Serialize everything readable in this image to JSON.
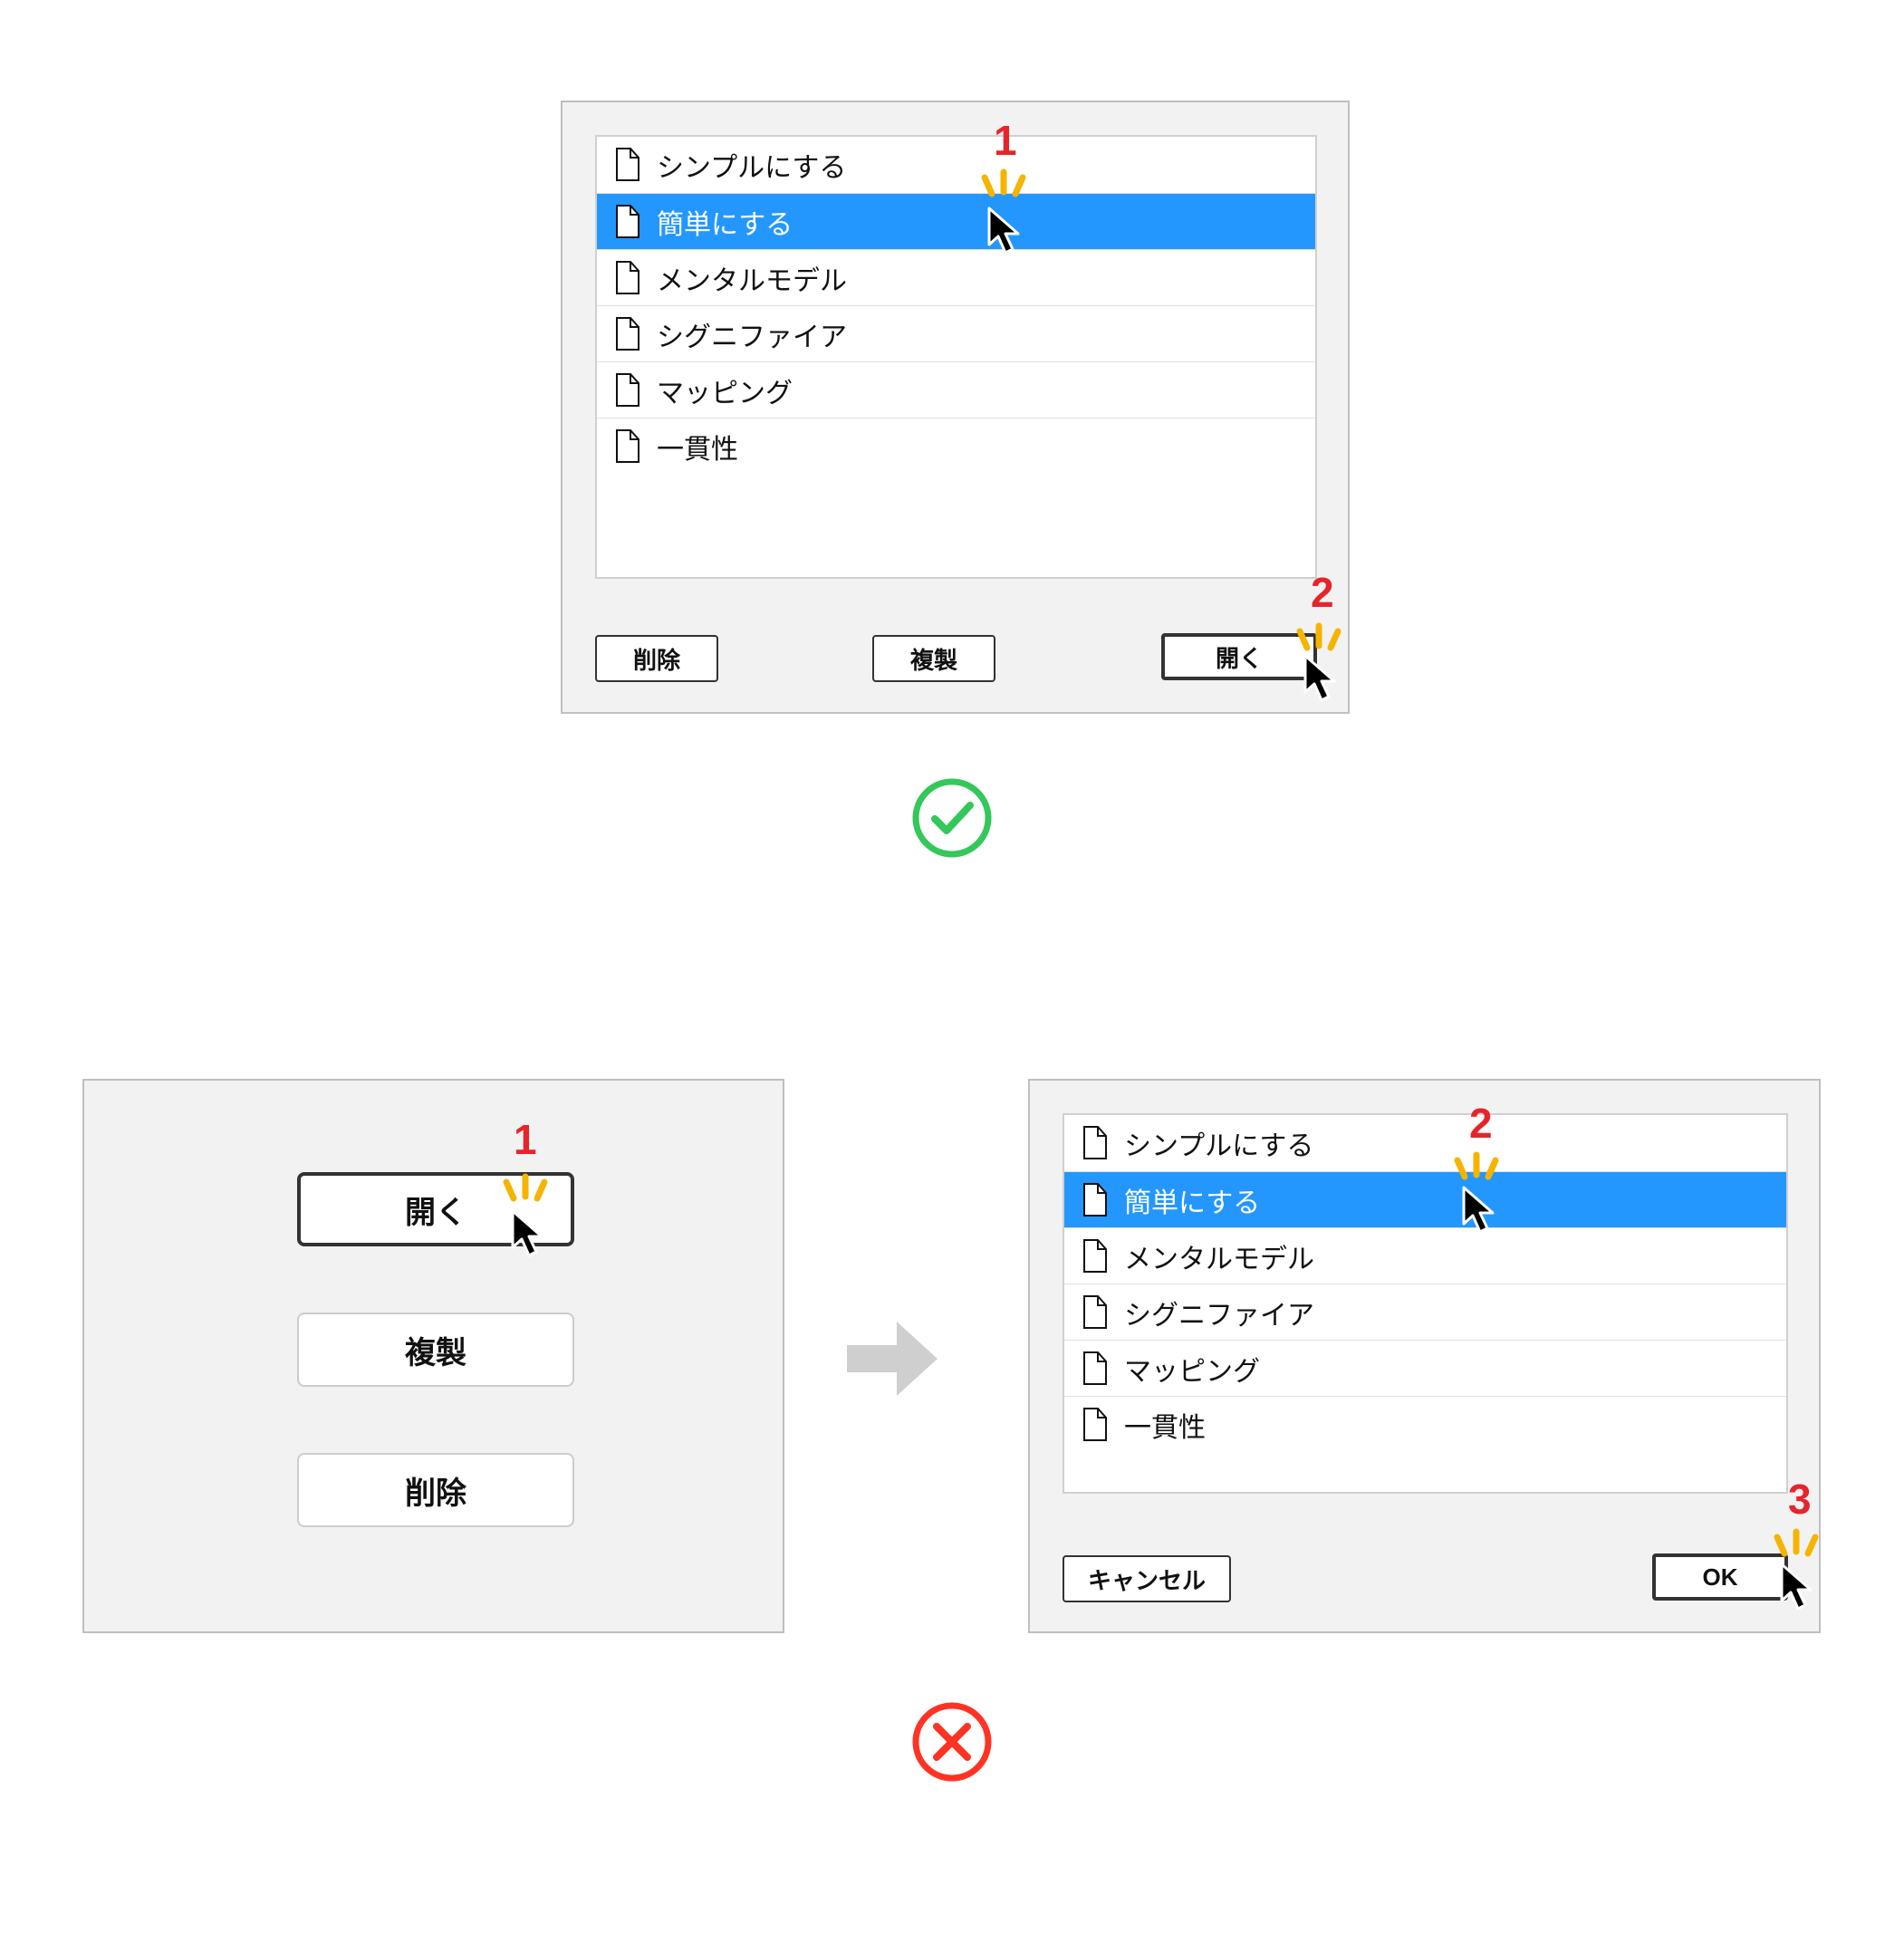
{
  "good": {
    "list": [
      {
        "label": "シンプルにする",
        "selected": false
      },
      {
        "label": "簡単にする",
        "selected": true
      },
      {
        "label": "メンタルモデル",
        "selected": false
      },
      {
        "label": "シグニファイア",
        "selected": false
      },
      {
        "label": "マッピング",
        "selected": false
      },
      {
        "label": "一貫性",
        "selected": false
      }
    ],
    "buttons": {
      "delete": "削除",
      "duplicate": "複製",
      "open": "開く"
    },
    "steps": {
      "s1": "1",
      "s2": "2"
    }
  },
  "bad": {
    "left": {
      "buttons": {
        "open": "開く",
        "duplicate": "複製",
        "delete": "削除"
      },
      "steps": {
        "s1": "1"
      }
    },
    "right": {
      "list": [
        {
          "label": "シンプルにする",
          "selected": false
        },
        {
          "label": "簡単にする",
          "selected": true
        },
        {
          "label": "メンタルモデル",
          "selected": false
        },
        {
          "label": "シグニファイア",
          "selected": false
        },
        {
          "label": "マッピング",
          "selected": false
        },
        {
          "label": "一貫性",
          "selected": false
        }
      ],
      "buttons": {
        "cancel": "キャンセル",
        "ok": "OK"
      },
      "steps": {
        "s2": "2",
        "s3": "3"
      }
    }
  }
}
